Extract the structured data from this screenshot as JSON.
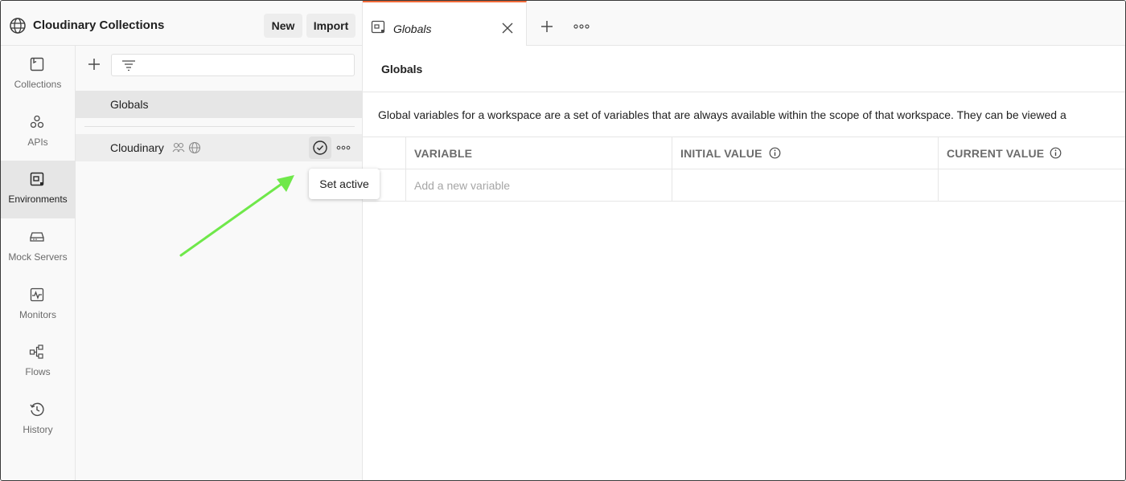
{
  "workspace": {
    "title": "Cloudinary Collections",
    "new_label": "New",
    "import_label": "Import"
  },
  "rail": {
    "items": [
      {
        "label": "Collections",
        "icon": "collections-icon"
      },
      {
        "label": "APIs",
        "icon": "apis-icon"
      },
      {
        "label": "Environments",
        "icon": "environments-icon",
        "active": true
      },
      {
        "label": "Mock Servers",
        "icon": "mock-servers-icon"
      },
      {
        "label": "Monitors",
        "icon": "monitors-icon"
      },
      {
        "label": "Flows",
        "icon": "flows-icon"
      },
      {
        "label": "History",
        "icon": "history-icon"
      }
    ]
  },
  "sidebar": {
    "globals_label": "Globals",
    "environment_label": "Cloudinary",
    "tooltip": "Set active"
  },
  "tabs": {
    "active_label": "Globals"
  },
  "main": {
    "title": "Globals",
    "description": "Global variables for a workspace are a set of variables that are always available within the scope of that workspace. They can be viewed a",
    "columns": {
      "variable": "VARIABLE",
      "initial_value": "INITIAL VALUE",
      "current_value": "CURRENT VALUE"
    },
    "new_variable_placeholder": "Add a new variable"
  },
  "colors": {
    "accent": "#f26b3a",
    "annotation_arrow": "#6fe84a"
  }
}
